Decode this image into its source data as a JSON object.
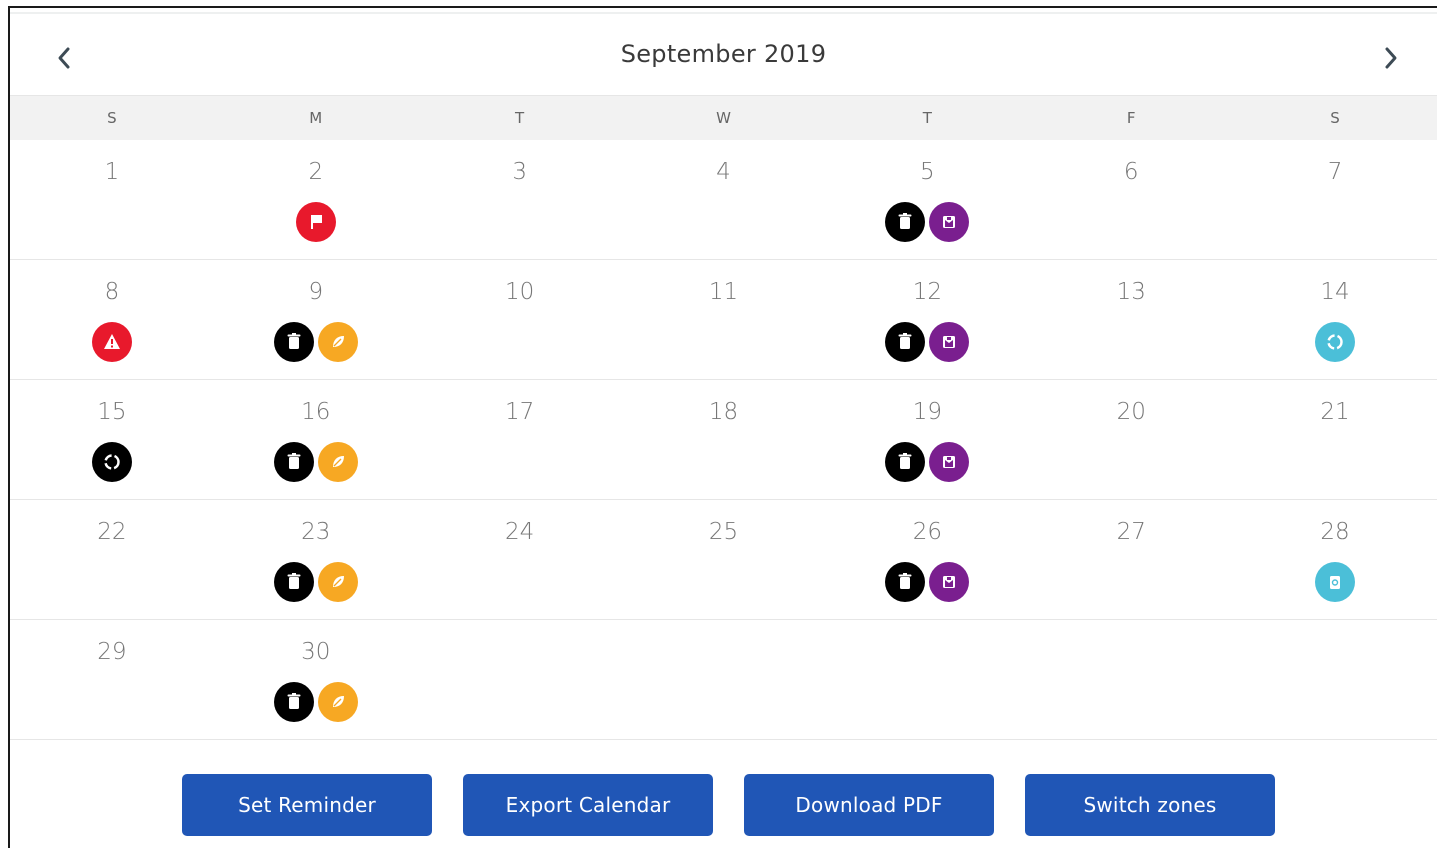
{
  "calendar": {
    "month_title": "September 2019",
    "weekdays": [
      "S",
      "M",
      "T",
      "W",
      "T",
      "F",
      "S"
    ],
    "weeks": [
      [
        {
          "day": "1",
          "icons": []
        },
        {
          "day": "2",
          "icons": [
            "flag-icon"
          ]
        },
        {
          "day": "3",
          "icons": []
        },
        {
          "day": "4",
          "icons": []
        },
        {
          "day": "5",
          "icons": [
            "trash-bin-icon",
            "bulky-item-icon"
          ]
        },
        {
          "day": "6",
          "icons": []
        },
        {
          "day": "7",
          "icons": []
        }
      ],
      [
        {
          "day": "8",
          "icons": [
            "warning-icon"
          ]
        },
        {
          "day": "9",
          "icons": [
            "trash-bin-icon",
            "leaf-icon"
          ]
        },
        {
          "day": "10",
          "icons": []
        },
        {
          "day": "11",
          "icons": []
        },
        {
          "day": "12",
          "icons": [
            "trash-bin-icon",
            "bulky-item-icon"
          ]
        },
        {
          "day": "13",
          "icons": []
        },
        {
          "day": "14",
          "icons": [
            "recycle-teal-icon"
          ]
        }
      ],
      [
        {
          "day": "15",
          "icons": [
            "recycle-black-icon"
          ]
        },
        {
          "day": "16",
          "icons": [
            "trash-bin-icon",
            "leaf-icon"
          ]
        },
        {
          "day": "17",
          "icons": []
        },
        {
          "day": "18",
          "icons": []
        },
        {
          "day": "19",
          "icons": [
            "trash-bin-icon",
            "bulky-item-icon"
          ]
        },
        {
          "day": "20",
          "icons": []
        },
        {
          "day": "21",
          "icons": []
        }
      ],
      [
        {
          "day": "22",
          "icons": []
        },
        {
          "day": "23",
          "icons": [
            "trash-bin-icon",
            "leaf-icon"
          ]
        },
        {
          "day": "24",
          "icons": []
        },
        {
          "day": "25",
          "icons": []
        },
        {
          "day": "26",
          "icons": [
            "trash-bin-icon",
            "bulky-item-icon"
          ]
        },
        {
          "day": "27",
          "icons": []
        },
        {
          "day": "28",
          "icons": [
            "recycle-bin-teal-icon"
          ]
        }
      ],
      [
        {
          "day": "29",
          "icons": []
        },
        {
          "day": "30",
          "icons": [
            "trash-bin-icon",
            "leaf-icon"
          ]
        },
        {
          "day": "",
          "icons": []
        },
        {
          "day": "",
          "icons": []
        },
        {
          "day": "",
          "icons": []
        },
        {
          "day": "",
          "icons": []
        },
        {
          "day": "",
          "icons": []
        }
      ]
    ]
  },
  "actions": {
    "set_reminder": "Set Reminder",
    "export_calendar": "Export Calendar",
    "download_pdf": "Download PDF",
    "switch_zones": "Switch zones"
  },
  "colors": {
    "button_blue": "#2056b6",
    "trash_black": "#000000",
    "bulky_purple": "#7a1f8f",
    "leaf_orange": "#f7a823",
    "alert_red": "#e8192c",
    "recycle_teal": "#4bbfd8"
  }
}
